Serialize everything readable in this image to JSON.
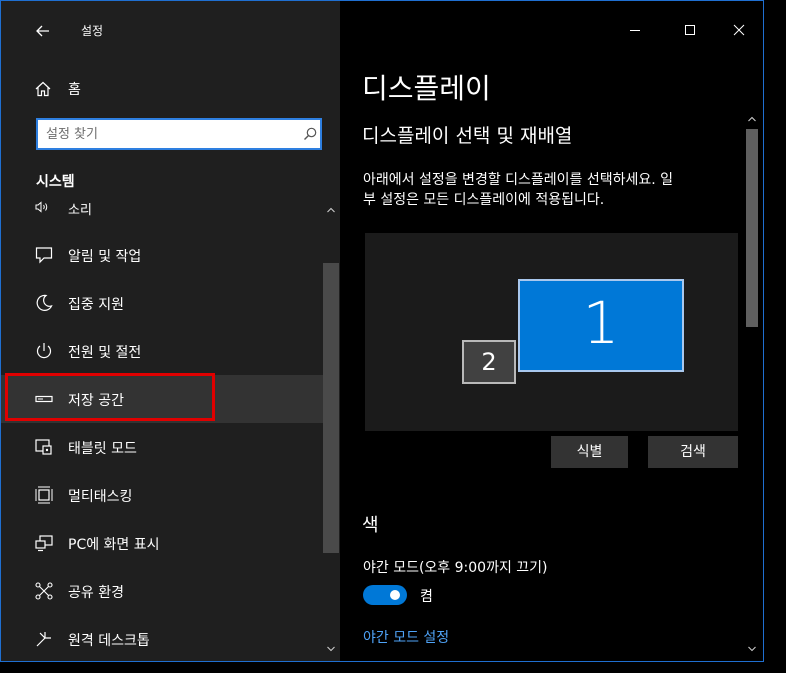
{
  "window": {
    "title": "설정",
    "border_color": "#1f6fd1"
  },
  "sidebar": {
    "home_label": "홈",
    "search_placeholder": "설정 찾기",
    "section_header": "시스템",
    "items": [
      {
        "label": "소리",
        "icon": "speaker-icon"
      },
      {
        "label": "알림 및 작업",
        "icon": "notification-icon"
      },
      {
        "label": "집중 지원",
        "icon": "moon-icon"
      },
      {
        "label": "전원 및 절전",
        "icon": "power-icon"
      },
      {
        "label": "저장 공간",
        "icon": "storage-icon",
        "selected": true
      },
      {
        "label": "태블릿 모드",
        "icon": "tablet-icon"
      },
      {
        "label": "멀티태스킹",
        "icon": "multitasking-icon"
      },
      {
        "label": "PC에 화면 표시",
        "icon": "project-icon"
      },
      {
        "label": "공유 환경",
        "icon": "share-icon"
      },
      {
        "label": "원격 데스크톱",
        "icon": "remote-desktop-icon"
      }
    ]
  },
  "main": {
    "page_title": "디스플레이",
    "section_title": "디스플레이 선택 및 재배열",
    "description_line1": "아래에서 설정을 변경할 디스플레이를 선택하세요. 일",
    "description_line2": "부 설정은 모든 디스플레이에 적용됩니다.",
    "monitors": [
      {
        "label": "1",
        "selected": true
      },
      {
        "label": "2",
        "selected": false
      }
    ],
    "identify_button": "식별",
    "detect_button": "검색",
    "color_title": "색",
    "night_light_label": "야간 모드(오후 9:00까지 끄기)",
    "night_light_toggle_on": true,
    "night_light_state": "켬",
    "night_light_settings_link": "야간 모드 설정"
  },
  "colors": {
    "accent": "#0078d7",
    "highlight_box": "#e00000",
    "link": "#4fa3f7"
  }
}
